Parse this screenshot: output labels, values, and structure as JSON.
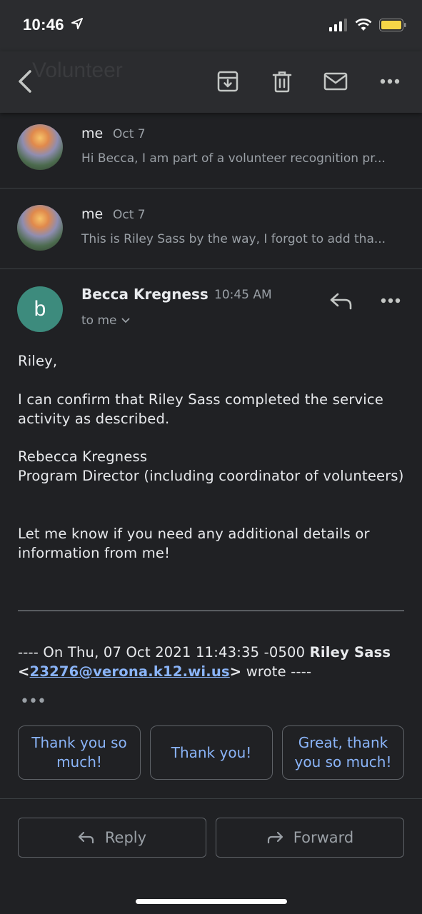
{
  "status_bar": {
    "time": "10:46"
  },
  "toolbar": {
    "ghost_title": "Volunteer"
  },
  "thread": [
    {
      "sender": "me",
      "date": "Oct 7",
      "snippet": "Hi Becca, I am part of a volunteer recognition pr..."
    },
    {
      "sender": "me",
      "date": "Oct 7",
      "snippet": "This is Riley Sass by the way, I forgot to add tha..."
    }
  ],
  "message": {
    "avatar_letter": "b",
    "avatar_color": "#3d8b7d",
    "sender": "Becca Kregness",
    "time": "10:45 AM",
    "recipient": "to me",
    "greeting": "Riley,",
    "para1": "I can confirm that Riley Sass completed the service activity as described.",
    "sig_name": "Rebecca Kregness",
    "sig_title": "Program Director (including coordinator of volunteers)",
    "para2": "Let me know if you need any additional details or information from me!",
    "quote_prefix": "---- On Thu, 07 Oct 2021 11:43:35 -0500 ",
    "quote_name": "Riley Sass",
    "quote_lt": " <",
    "quote_email": "23276@verona.k12.wi.us",
    "quote_gt": ">",
    "quote_suffix": " wrote ----"
  },
  "smart_replies": [
    "Thank you so much!",
    "Thank you!",
    "Great, thank you so much!"
  ],
  "actions": {
    "reply": "Reply",
    "forward": "Forward"
  }
}
